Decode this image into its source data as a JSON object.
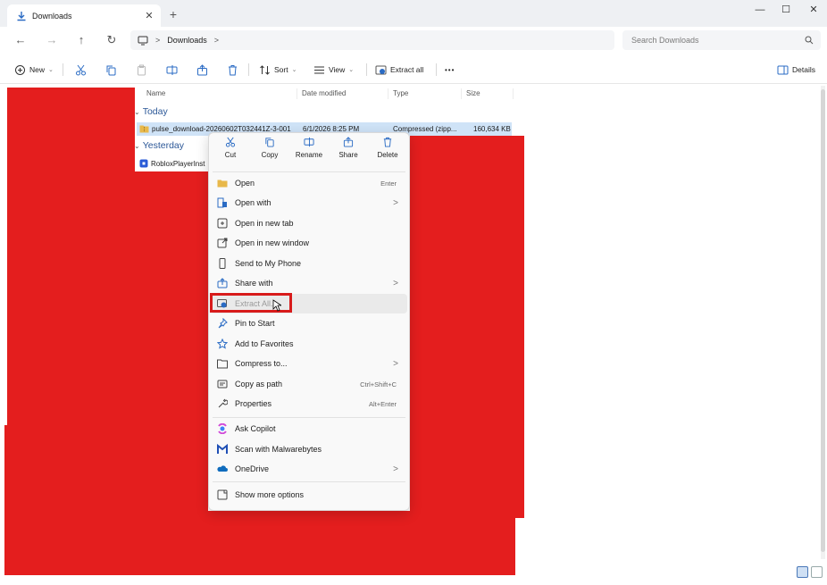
{
  "window": {
    "tab_title": "Downloads",
    "tab_close": "✕",
    "new_tab": "+",
    "minimize": "—",
    "maximize": "☐",
    "close": "✕"
  },
  "nav": {
    "back": "←",
    "forward": "→",
    "up": "↑",
    "refresh": "↻"
  },
  "address": {
    "crumb_sep_1": ">",
    "crumb": "Downloads",
    "crumb_sep_2": ">"
  },
  "search": {
    "placeholder": "Search Downloads"
  },
  "commandbar": {
    "new_label": "New",
    "sort_label": "Sort",
    "view_label": "View",
    "extract_all_label": "Extract all",
    "more_label": "•••",
    "details_label": "Details"
  },
  "columns": {
    "name": "Name",
    "date_modified": "Date modified",
    "type": "Type",
    "size": "Size"
  },
  "groups": {
    "today": "Today",
    "yesterday": "Yesterday"
  },
  "files": [
    {
      "name": "pulse_download-20260602T032441Z-3-001",
      "date": "6/1/2026 8:25 PM",
      "type": "Compressed (zipp...",
      "size": "160,634 KB"
    },
    {
      "name": "RobloxPlayerInst"
    }
  ],
  "context_menu": {
    "quick_actions": [
      {
        "label": "Cut",
        "icon": "scissors-icon"
      },
      {
        "label": "Copy",
        "icon": "copy-icon"
      },
      {
        "label": "Rename",
        "icon": "rename-icon"
      },
      {
        "label": "Share",
        "icon": "share-icon"
      },
      {
        "label": "Delete",
        "icon": "trash-icon"
      }
    ],
    "items": [
      {
        "label": "Open",
        "shortcut": "Enter"
      },
      {
        "label": "Open with",
        "arrow": ">"
      },
      {
        "label": "Open in new tab"
      },
      {
        "label": "Open in new window"
      },
      {
        "label": "Send to My Phone"
      },
      {
        "label": "Share with",
        "arrow": ">"
      },
      {
        "label": "Extract All..."
      },
      {
        "label": "Pin to Start"
      },
      {
        "label": "Add to Favorites"
      },
      {
        "label": "Compress to...",
        "arrow": ">"
      },
      {
        "label": "Copy as path",
        "shortcut": "Ctrl+Shift+C"
      },
      {
        "label": "Properties",
        "shortcut": "Alt+Enter"
      },
      {
        "label": "Ask Copilot"
      },
      {
        "label": "Scan with Malwarebytes"
      },
      {
        "label": "OneDrive",
        "arrow": ">"
      },
      {
        "label": "Show more options"
      }
    ]
  },
  "colors": {
    "redaction": "#e41e1e",
    "selection": "#cfe3f7",
    "group_header": "#2b5797",
    "highlight_box": "#d81b1b"
  }
}
